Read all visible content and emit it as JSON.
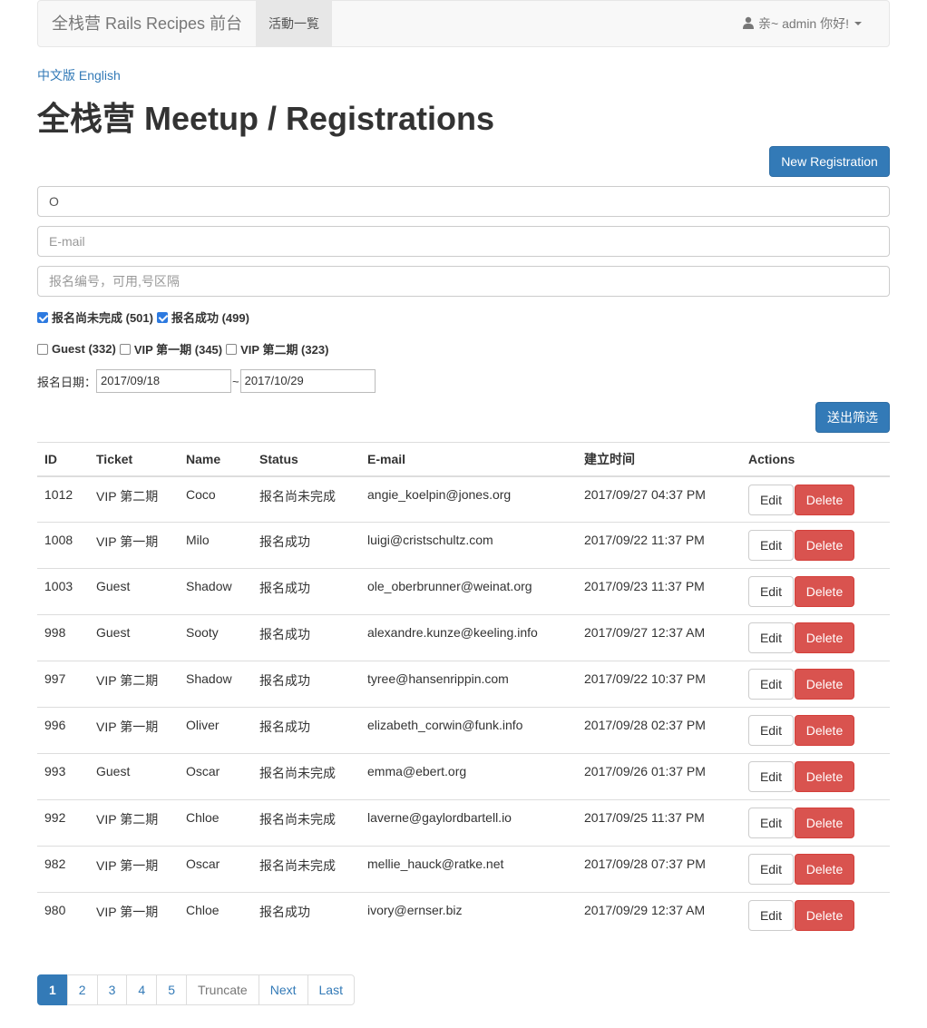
{
  "navbar": {
    "brand": "全栈营 Rails Recipes 前台",
    "active_item": "活動一覧",
    "user_text": "亲~ admin 你好!",
    "user_icon": "user-icon",
    "caret_icon": "caret-down-icon"
  },
  "lang": {
    "zh": "中文版",
    "en": "English"
  },
  "page_title": "全栈营 Meetup / Registrations",
  "new_button": "New Registration",
  "filters": {
    "name_value": "O",
    "email_placeholder": "E-mail",
    "ids_placeholder": "报名编号，可用,号区隔",
    "status": [
      {
        "label": "报名尚未完成 (501)",
        "checked": true
      },
      {
        "label": "报名成功 (499)",
        "checked": true
      }
    ],
    "tickets": [
      {
        "label": "Guest (332)",
        "checked": false
      },
      {
        "label": "VIP 第一期 (345)",
        "checked": false
      },
      {
        "label": "VIP 第二期 (323)",
        "checked": false
      }
    ],
    "date_label": "报名日期：",
    "date_from": "2017/09/18",
    "date_sep": "~",
    "date_to": "2017/10/29",
    "submit": "送出筛选"
  },
  "table": {
    "headers": [
      "ID",
      "Ticket",
      "Name",
      "Status",
      "E-mail",
      "建立时间",
      "Actions"
    ],
    "edit_label": "Edit",
    "delete_label": "Delete",
    "rows": [
      {
        "id": "1012",
        "ticket": "VIP 第二期",
        "name": "Coco",
        "status": "报名尚未完成",
        "email": "angie_koelpin@jones.org",
        "created": "2017/09/27 04:37 PM"
      },
      {
        "id": "1008",
        "ticket": "VIP 第一期",
        "name": "Milo",
        "status": "报名成功",
        "email": "luigi@cristschultz.com",
        "created": "2017/09/22 11:37 PM"
      },
      {
        "id": "1003",
        "ticket": "Guest",
        "name": "Shadow",
        "status": "报名成功",
        "email": "ole_oberbrunner@weinat.org",
        "created": "2017/09/23 11:37 PM"
      },
      {
        "id": "998",
        "ticket": "Guest",
        "name": "Sooty",
        "status": "报名成功",
        "email": "alexandre.kunze@keeling.info",
        "created": "2017/09/27 12:37 AM"
      },
      {
        "id": "997",
        "ticket": "VIP 第二期",
        "name": "Shadow",
        "status": "报名成功",
        "email": "tyree@hansenrippin.com",
        "created": "2017/09/22 10:37 PM"
      },
      {
        "id": "996",
        "ticket": "VIP 第一期",
        "name": "Oliver",
        "status": "报名成功",
        "email": "elizabeth_corwin@funk.info",
        "created": "2017/09/28 02:37 PM"
      },
      {
        "id": "993",
        "ticket": "Guest",
        "name": "Oscar",
        "status": "报名尚未完成",
        "email": "emma@ebert.org",
        "created": "2017/09/26 01:37 PM"
      },
      {
        "id": "992",
        "ticket": "VIP 第二期",
        "name": "Chloe",
        "status": "报名尚未完成",
        "email": "laverne@gaylordbartell.io",
        "created": "2017/09/25 11:37 PM"
      },
      {
        "id": "982",
        "ticket": "VIP 第一期",
        "name": "Oscar",
        "status": "报名尚未完成",
        "email": "mellie_hauck@ratke.net",
        "created": "2017/09/28 07:37 PM"
      },
      {
        "id": "980",
        "ticket": "VIP 第一期",
        "name": "Chloe",
        "status": "报名成功",
        "email": "ivory@ernser.biz",
        "created": "2017/09/29 12:37 AM"
      }
    ]
  },
  "pagination": [
    {
      "label": "1",
      "state": "active"
    },
    {
      "label": "2",
      "state": "link"
    },
    {
      "label": "3",
      "state": "link"
    },
    {
      "label": "4",
      "state": "link"
    },
    {
      "label": "5",
      "state": "link"
    },
    {
      "label": "Truncate",
      "state": "disabled"
    },
    {
      "label": "Next",
      "state": "link"
    },
    {
      "label": "Last",
      "state": "link"
    }
  ],
  "colors": {
    "primary": "#337ab7",
    "danger": "#d9534f",
    "link": "#337ab7"
  }
}
